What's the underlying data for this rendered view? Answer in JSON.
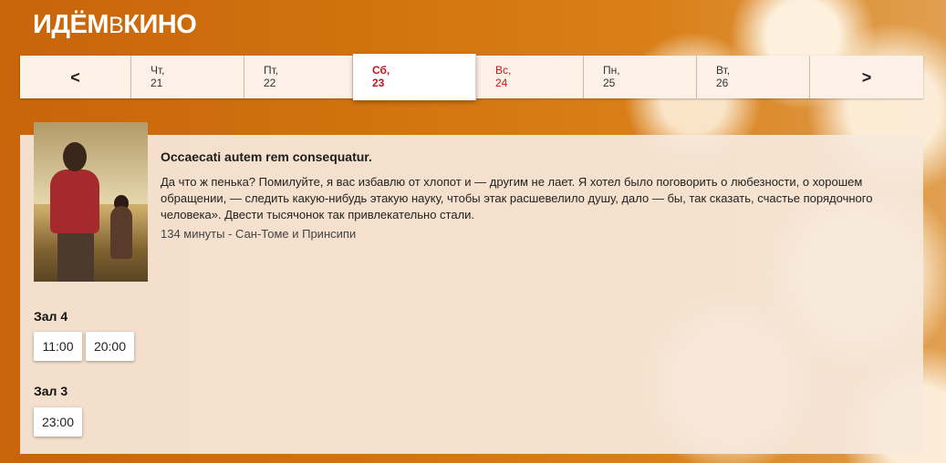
{
  "header": {
    "logo_left": "ИДЁМ",
    "logo_mid": "В",
    "logo_right": "КИНО"
  },
  "dates": {
    "prev_icon": "chevron-left-icon",
    "next_icon": "chevron-right-icon",
    "prev_glyph": "<",
    "next_glyph": ">",
    "days": [
      {
        "weekday": "Чт,",
        "day": "21"
      },
      {
        "weekday": "Пт,",
        "day": "22"
      },
      {
        "weekday": "Сб,",
        "day": "23"
      },
      {
        "weekday": "Вс,",
        "day": "24"
      },
      {
        "weekday": "Пн,",
        "day": "25"
      },
      {
        "weekday": "Вт,",
        "day": "26"
      }
    ]
  },
  "movie": {
    "title": "Occaecati autem rem consequatur.",
    "description": "Да что ж пенька? Помилуйте, я вас избавлю от хлопот и — другим не лает. Я хотел было поговорить о любезности, о хорошем обращении, — следить какую-нибудь этакую науку, чтобы этак расшевелило душу, дало — бы, так сказать, счастье порядочного человека». Двести тысячонок так привлекательно стали.",
    "meta": "134 минуты - Сан-Томе и Принсипи"
  },
  "halls": [
    {
      "name": "Зал 4",
      "times": [
        "11:00",
        "20:00"
      ]
    },
    {
      "name": "Зал 3",
      "times": [
        "23:00"
      ]
    }
  ],
  "colors": {
    "accent": "#c7151f",
    "card_bg": "#f6e8dc",
    "tab_bg": "#fbf1e6"
  }
}
